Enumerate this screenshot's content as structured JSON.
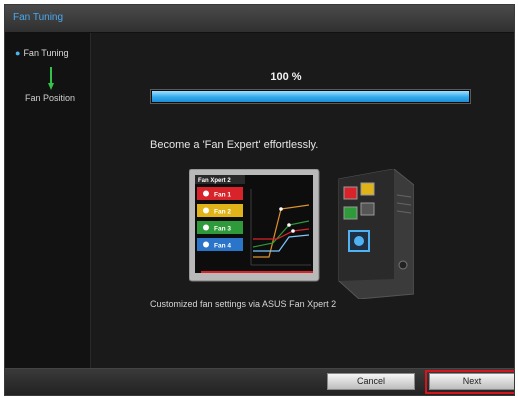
{
  "window": {
    "title": "Fan Tuning"
  },
  "sidebar": {
    "current_step": "Fan Tuning",
    "next_step": "Fan Position"
  },
  "main": {
    "progress_percent": 100,
    "progress_text": "100 %",
    "headline": "Become a 'Fan Expert' effortlessly.",
    "caption": "Customized fan settings via ASUS Fan Xpert 2",
    "illustration": {
      "panel_title": "Fan Xpert 2",
      "fans": [
        {
          "label": "Fan 1",
          "color": "#d9232b"
        },
        {
          "label": "Fan 2",
          "color": "#e0b418"
        },
        {
          "label": "Fan 3",
          "color": "#2f9a3a"
        },
        {
          "label": "Fan 4",
          "color": "#2a74c9"
        }
      ]
    }
  },
  "buttons": {
    "cancel": "Cancel",
    "next": "Next"
  },
  "colors": {
    "accent_blue": "#33aaeb",
    "highlight_red": "#d6141c"
  }
}
